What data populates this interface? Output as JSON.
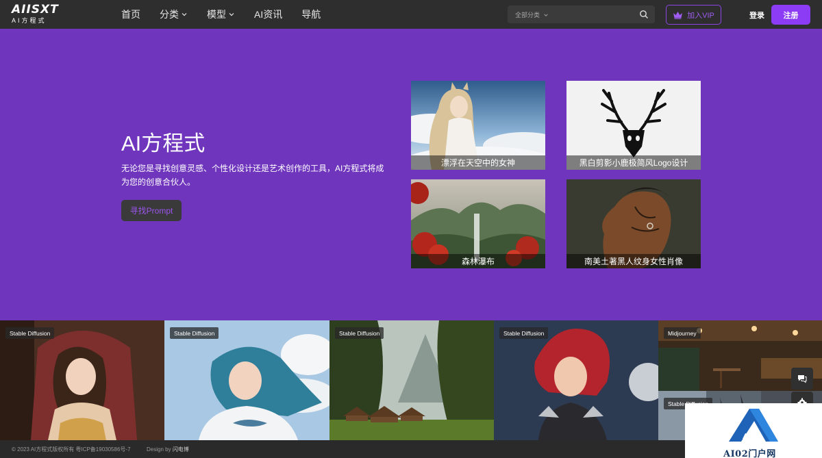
{
  "header": {
    "logo": {
      "mark": "AIISXT",
      "subtitle": "AI方程式"
    },
    "nav": [
      {
        "label": "首页",
        "has_dropdown": false
      },
      {
        "label": "分类",
        "has_dropdown": true
      },
      {
        "label": "模型",
        "has_dropdown": true
      },
      {
        "label": "AI资讯",
        "has_dropdown": false
      },
      {
        "label": "导航",
        "has_dropdown": false
      }
    ],
    "search": {
      "category_label": "全部分类",
      "value": "",
      "placeholder": ""
    },
    "vip_label": "加入VIP",
    "login_label": "登录",
    "register_label": "注册"
  },
  "hero": {
    "title": "AI方程式",
    "description": "无论您是寻找创意灵感、个性化设计还是艺术创作的工具，AI方程式将成为您的创意合伙人。",
    "cta_label": "寻找Prompt",
    "cards": [
      {
        "caption": "漂浮在天空中的女神",
        "icon": "goddess-image"
      },
      {
        "caption": "黑白剪影小鹿极简风Logo设计",
        "icon": "deer-logo-image"
      },
      {
        "caption": "森林瀑布",
        "icon": "forest-waterfall-image"
      },
      {
        "caption": "南美土著黑人纹身女性肖像",
        "icon": "tattoo-portrait-image"
      }
    ]
  },
  "gallery": [
    {
      "tag": "Stable Diffusion",
      "icon": "baroque-girl-image"
    },
    {
      "tag": "Stable Diffusion",
      "icon": "blue-hair-girl-image"
    },
    {
      "tag": "Stable Diffusion",
      "icon": "forest-cabins-image"
    },
    {
      "tag": "Stable Diffusion",
      "icon": "red-hair-warrior-image"
    },
    {
      "tag": "Midjourney",
      "icon": "cafe-interior-image"
    },
    {
      "tag": "Stable Diffusion",
      "icon": "street-scene-image"
    }
  ],
  "footer": {
    "copyright": "© 2023 AI方程式版权所有 粤ICP备19030586号-7",
    "design_prefix": "Design by",
    "design_link": "闪电博"
  },
  "watermark": {
    "text": "AI02门户网"
  },
  "colors": {
    "hero_bg": "#6f36bd",
    "header_bg": "#2e2e2e",
    "accent": "#8c3cf5",
    "vip": "#9e5cf0"
  }
}
